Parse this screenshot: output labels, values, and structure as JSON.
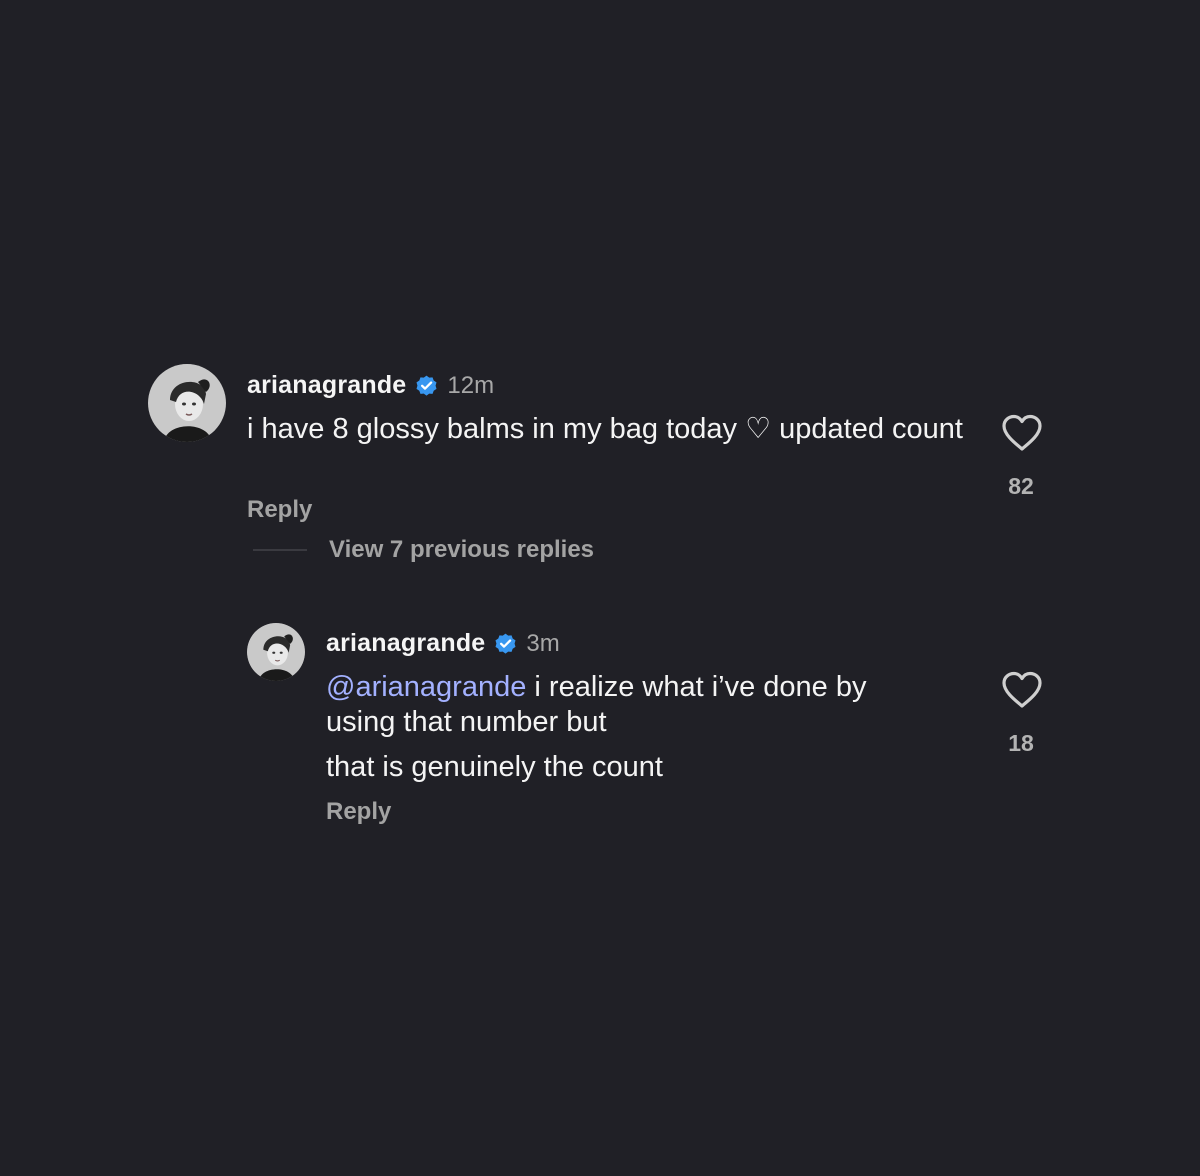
{
  "comments": [
    {
      "username": "arianagrande",
      "time": "12m",
      "text": "i have 8 glossy balms in my bag today ♡ updated count",
      "reply_label": "Reply",
      "likes": "82"
    },
    {
      "username": "arianagrande",
      "time": "3m",
      "mention": "@arianagrande",
      "text_line1": " i realize what i’ve done by",
      "text_line2": "using that number but",
      "text_line3": "that is genuinely the count",
      "reply_label": "Reply",
      "likes": "18"
    }
  ],
  "view_replies_label": "View 7 previous replies",
  "colors": {
    "background": "#202026",
    "verified": "#3897f0",
    "mention": "#a3b1ff",
    "muted": "#a3a3a3"
  }
}
